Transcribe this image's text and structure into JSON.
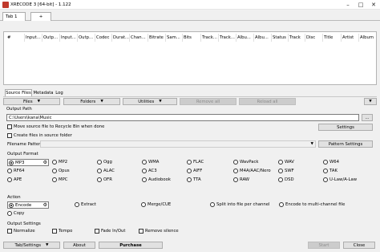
{
  "window": {
    "title": "XRECODE 3 [64-bit] - 1.122",
    "minimize": "–",
    "maximize": "□",
    "close": "✕"
  },
  "tabs": [
    {
      "label": "Tab 1"
    },
    {
      "label": "+"
    }
  ],
  "grid": {
    "columns": [
      "#",
      "Input...",
      "Outp...",
      "Input...",
      "Outp...",
      "Codec",
      "Durat...",
      "Chan...",
      "Bitrate",
      "Sam...",
      "Bits",
      "Track...",
      "Track...",
      "Albu...",
      "Albu...",
      "Status",
      "Track",
      "Disc",
      "Title",
      "Artist",
      "Album"
    ]
  },
  "subtabs": [
    {
      "label": "Source Files"
    },
    {
      "label": "Metadata"
    },
    {
      "label": "Log"
    }
  ],
  "toolbar": {
    "files": "Files",
    "folders": "Folders",
    "utilities": "Utilities",
    "remove_all": "Remove all",
    "reload_all": "Reload all",
    "more": "▼"
  },
  "output_path": {
    "label": "Output Path",
    "value": "C:\\Users\\kana\\Music",
    "browse": "...",
    "settings": "Settings"
  },
  "options": {
    "move_source": "Move source file to Recycle Bin when done",
    "create_files": "Create files in source folder"
  },
  "filename": {
    "label": "Filename Pattern",
    "value": "",
    "button": "Pattern Settings"
  },
  "output_format": {
    "label": "Output Format",
    "selected": "MP3",
    "items": [
      "MP3",
      "MP2",
      "Ogg",
      "WMA",
      "FLAC",
      "WavPack",
      "WAV",
      "W64",
      "RF64",
      "Opus",
      "ALAC",
      "AC3",
      "AIFF",
      "M4A/AAC/Nero",
      "SWF",
      "TAK",
      "APE",
      "MPC",
      "OFR",
      "Audiobook",
      "TTA",
      "RAW",
      "DSD",
      "U-Law/A-Law"
    ]
  },
  "action": {
    "label": "Action",
    "items": [
      "Encode",
      "Extract",
      "Merge/CUE",
      "Split into file per channel",
      "Encode to multi-channel file",
      "Copy"
    ],
    "selected": "Encode"
  },
  "output_settings": {
    "label": "Output Settings",
    "items": [
      "Normalize",
      "Tempo",
      "Fade In/Out",
      "Remove silence"
    ]
  },
  "footer": {
    "tab_settings": "Tab/Settings",
    "about": "About",
    "purchase": "Purchase",
    "start": "Start",
    "close": "Close"
  }
}
